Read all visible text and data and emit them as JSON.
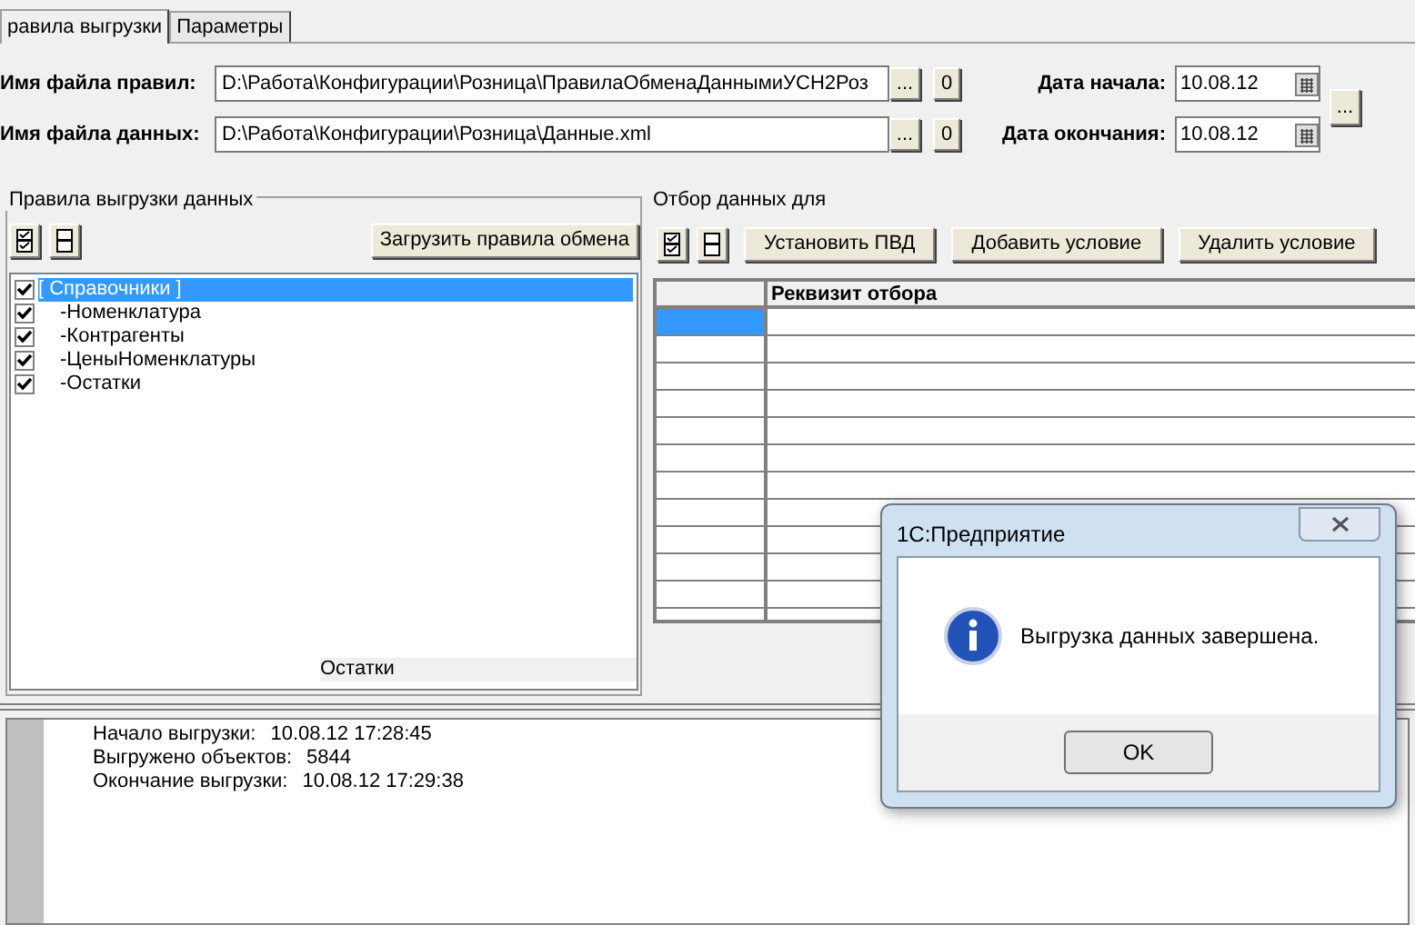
{
  "tabs": [
    {
      "label": "равила выгрузки",
      "selected": true
    },
    {
      "label": "Параметры",
      "selected": false
    }
  ],
  "files": [
    {
      "label": "Имя файла правил:",
      "value": "D:\\Работа\\Конфигурации\\Розница\\ПравилаОбменаДаннымиУСН2Роз",
      "browse": "...",
      "clear": "0"
    },
    {
      "label": "Имя файла данных:",
      "value": "D:\\Работа\\Конфигурации\\Розница\\Данные.xml",
      "browse": "...",
      "clear": "0"
    }
  ],
  "dates": [
    {
      "label": "Дата начала:",
      "value": "10.08.12"
    },
    {
      "label": "Дата окончания:",
      "value": "10.08.12"
    }
  ],
  "period_button": "...",
  "rules_group": {
    "title": "Правила выгрузки данных",
    "load_button": "Загрузить правила обмена",
    "status": "Остатки",
    "items": [
      {
        "label": "[ Справочники ]",
        "checked": true,
        "selected": true,
        "children": [
          {
            "label": "-Номенклатура",
            "checked": true,
            "selected": false
          },
          {
            "label": "-Контрагенты",
            "checked": true,
            "selected": false
          },
          {
            "label": "-ЦеныНоменклатуры",
            "checked": true,
            "selected": false
          },
          {
            "label": "-Остатки",
            "checked": true,
            "selected": false
          }
        ]
      }
    ]
  },
  "filter_group": {
    "title": "Отбор данных для",
    "buttons": [
      "Установить ПВД",
      "Добавить условие",
      "Удалить условие"
    ],
    "column_2": "Реквизит отбора",
    "rows": [
      {
        "selected": true
      },
      {
        "selected": false
      },
      {
        "selected": false
      },
      {
        "selected": false
      },
      {
        "selected": false
      },
      {
        "selected": false
      },
      {
        "selected": false
      },
      {
        "selected": false
      },
      {
        "selected": false
      },
      {
        "selected": false
      },
      {
        "selected": false
      },
      {
        "selected": false
      }
    ]
  },
  "log": [
    {
      "label": "Начало выгрузки:",
      "value": "10.08.12 17:28:45"
    },
    {
      "label": "Выгружено объектов:",
      "value": "5844"
    },
    {
      "label": "Окончание выгрузки:",
      "value": "10.08.12 17:29:38"
    }
  ],
  "dialog": {
    "title": "1С:Предприятие",
    "message": "Выгрузка данных завершена.",
    "button": "OK"
  }
}
